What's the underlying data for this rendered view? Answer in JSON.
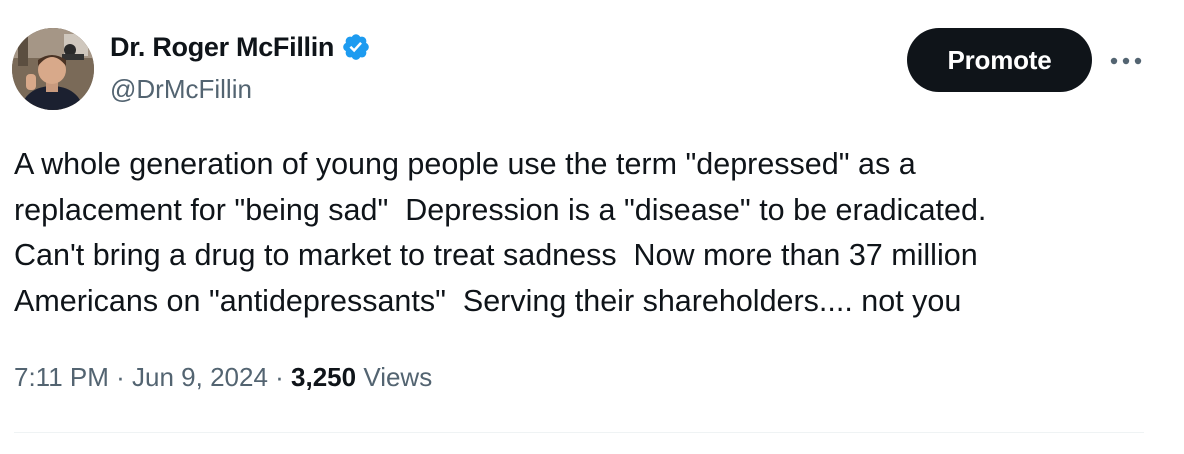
{
  "author": {
    "display_name": "Dr. Roger McFillin",
    "handle": "@DrMcFillin",
    "verified": true,
    "verified_color": "#1d9bf0"
  },
  "actions": {
    "promote_label": "Promote",
    "more_icon": "ellipsis-icon"
  },
  "tweet": {
    "lines": [
      "A whole generation of young people use the term \"depressed\" as a",
      "replacement for \"being sad\"  Depression is a \"disease\" to be eradicated.",
      "Can't bring a drug to market to treat sadness  Now more than 37 million",
      "Americans on \"antidepressants\"  Serving their shareholders.... not you"
    ]
  },
  "meta": {
    "time": "7:11 PM",
    "separator": " · ",
    "date": "Jun 9, 2024",
    "views_count": "3,250",
    "views_label": " Views"
  },
  "colors": {
    "text_primary": "#0f1419",
    "text_secondary": "#536471",
    "button_bg": "#0f1419",
    "divider": "#eff3f4"
  }
}
